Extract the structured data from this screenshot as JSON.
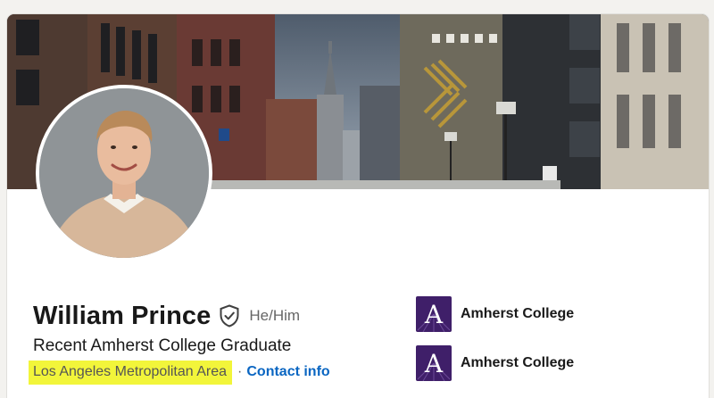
{
  "profile": {
    "name": "William Prince",
    "pronouns": "He/Him",
    "headline": "Recent Amherst College Graduate",
    "location": "Los Angeles Metropolitan Area",
    "separator": "·",
    "contact_label": "Contact info"
  },
  "cover": {
    "description": "city street with brick buildings and church spire"
  },
  "education": [
    {
      "label": "Amherst College",
      "logo_letter": "A",
      "logo_color": "#3f1f69"
    },
    {
      "label": "Amherst College",
      "logo_letter": "A",
      "logo_color": "#3f1f69"
    }
  ],
  "icons": {
    "verified": "shield-check-icon"
  },
  "colors": {
    "link": "#0a66c2",
    "highlight": "#f2f53a",
    "amherst_purple": "#3f1f69"
  }
}
